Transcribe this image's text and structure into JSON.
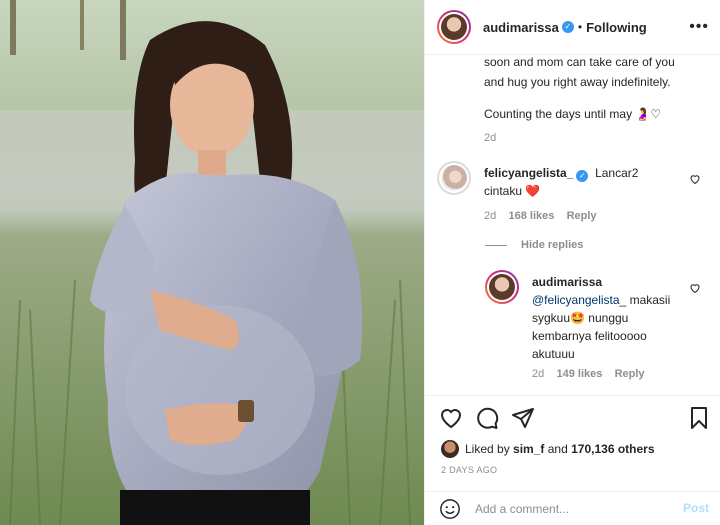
{
  "header": {
    "username": "audimarissa",
    "separator": "•",
    "follow_status": "Following",
    "more_icon": "more-horizontal-icon"
  },
  "caption": {
    "lines": [
      "soon and mom can take care of you",
      "and hug you right away indefinitely.",
      "",
      "Counting the days until may 🤰♡"
    ],
    "time": "2d"
  },
  "comments": [
    {
      "username": "felicyangelista_",
      "text_line1": "Lancar2",
      "text_line2": "cintaku ❤️",
      "time": "2d",
      "likes": "168 likes",
      "reply": "Reply"
    }
  ],
  "hide_replies": "Hide replies",
  "reply": {
    "username": "audimarissa",
    "mention": "@felicyangelista_",
    "text_line1": " makasii",
    "text_line2": "sygkuu🤩 nunggu",
    "text_line3": "kembarnya felitooooo",
    "text_line4": "akutuuu",
    "time": "2d",
    "likes": "149 likes",
    "reply": "Reply"
  },
  "actions": {
    "icons": [
      "heart-icon",
      "comment-icon",
      "share-icon",
      "bookmark-icon"
    ],
    "liked_by_prefix": "Liked by",
    "liked_by_user": "sim_f",
    "liked_by_and": "and",
    "liked_by_count": "170,136 others",
    "date": "2 DAYS AGO"
  },
  "add_comment": {
    "placeholder": "Add a comment...",
    "post": "Post"
  },
  "colors": {
    "text": "#262626",
    "muted": "#8e8e8e",
    "verified": "#3897f0",
    "post_disabled": "#b2dffc",
    "border": "#efefef"
  }
}
